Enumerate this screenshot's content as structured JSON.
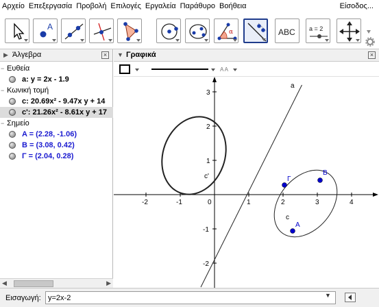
{
  "menu": [
    "Αρχείο",
    "Επεξεργασία",
    "Προβολή",
    "Επιλογές",
    "Εργαλεία",
    "Παράθυρο",
    "Βοήθεια"
  ],
  "signin": "Είσοδος...",
  "tools": [
    {
      "name": "move-tool",
      "label": ""
    },
    {
      "name": "point-tool",
      "label": "A"
    },
    {
      "name": "line-tool",
      "label": ""
    },
    {
      "name": "perpendicular-tool",
      "label": ""
    },
    {
      "name": "polygon-tool",
      "label": ""
    },
    {
      "name": "circle-tool",
      "label": ""
    },
    {
      "name": "ellipse-tool",
      "label": ""
    },
    {
      "name": "angle-tool",
      "label": "α"
    },
    {
      "name": "reflect-tool",
      "label": ""
    },
    {
      "name": "text-tool",
      "label": "ABC"
    },
    {
      "name": "slider-tool",
      "label": "a = 2"
    },
    {
      "name": "move-view-tool",
      "label": ""
    }
  ],
  "algebra": {
    "title": "Άλγεβρα",
    "categories": [
      {
        "label": "Ευθεία",
        "items": [
          {
            "text": "a: y = 2x - 1.9",
            "selected": false,
            "blue": false
          }
        ]
      },
      {
        "label": "Κωνική τομή",
        "items": [
          {
            "text": "c: 20.69x² - 9.47x y + 14",
            "selected": false,
            "blue": false
          },
          {
            "text": "c': 21.26x² - 8.61x y + 17",
            "selected": true,
            "blue": false
          }
        ]
      },
      {
        "label": "Σημείο",
        "items": [
          {
            "text": "A = (2.28, -1.06)",
            "selected": false,
            "blue": true
          },
          {
            "text": "B = (3.08, 0.42)",
            "selected": false,
            "blue": true
          },
          {
            "text": "Γ = (2.04, 0.28)",
            "selected": false,
            "blue": true
          }
        ]
      }
    ]
  },
  "graphics": {
    "title": "Γραφικά",
    "style_text": "A A",
    "x_ticks": [
      "-2",
      "-1",
      "0",
      "1",
      "2",
      "3",
      "4"
    ],
    "y_ticks": [
      "3",
      "2",
      "1",
      "-1",
      "-2"
    ],
    "labels": {
      "line": "a",
      "c": "c",
      "cprime": "c'",
      "A": "A",
      "B": "B",
      "G": "Γ"
    },
    "points": [
      {
        "name": "A",
        "x": 2.28,
        "y": -1.06
      },
      {
        "name": "B",
        "x": 3.08,
        "y": 0.42
      },
      {
        "name": "Γ",
        "x": 2.04,
        "y": 0.28
      }
    ]
  },
  "input": {
    "label": "Εισαγωγή:",
    "value": "y=2x-2"
  },
  "colors": {
    "accent": "#1f3c8c",
    "point": "#0000cc",
    "toolbar_bg": "#ffffff"
  }
}
